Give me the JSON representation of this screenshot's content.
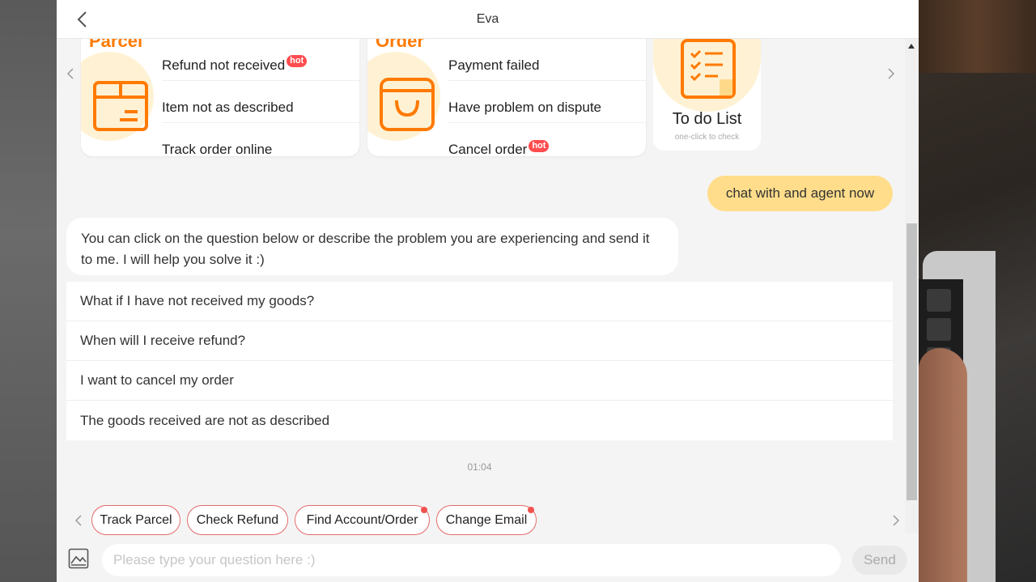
{
  "header": {
    "title": "Eva"
  },
  "cards": [
    {
      "heading": "Parcel",
      "items": [
        {
          "label": "Refund not received",
          "badge": "hot"
        },
        {
          "label": "Item not as described",
          "badge": ""
        },
        {
          "label": "Track order online",
          "badge": ""
        }
      ]
    },
    {
      "heading": "Order",
      "items": [
        {
          "label": "Payment failed",
          "badge": ""
        },
        {
          "label": "Have problem on dispute",
          "badge": ""
        },
        {
          "label": "Cancel order",
          "badge": "hot"
        }
      ]
    }
  ],
  "todo": {
    "title": "To do List",
    "subtitle": "one-click to check"
  },
  "messages": {
    "user": "chat with and agent now",
    "bot": "You can click on the question below or describe the problem you are experiencing and send it to me. I will help you solve it :)"
  },
  "faq": [
    "What if I have not received my goods?",
    "When will I receive refund?",
    "I want to cancel my order",
    "The goods received are not as described"
  ],
  "timestamp": "01:04",
  "quick_replies": [
    {
      "label": "Track Parcel",
      "dot": false
    },
    {
      "label": "Check Refund",
      "dot": false
    },
    {
      "label": "Find Account/Order",
      "dot": true
    },
    {
      "label": "Change Email",
      "dot": true
    }
  ],
  "composer": {
    "placeholder": "Please type your question here :)",
    "send_label": "Send"
  },
  "colors": {
    "accent": "#ff7a00",
    "user_bubble": "#ffdd8a",
    "hot_badge": "#ff4d4f",
    "chip_border": "#e36a6a"
  }
}
